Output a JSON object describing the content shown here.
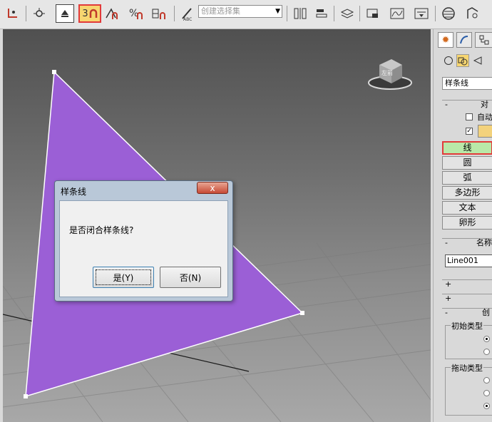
{
  "toolbar": {
    "selection_set_placeholder": "创建选择集",
    "snap_3d_label": "3"
  },
  "dialog": {
    "title": "样条线",
    "close_glyph": "x",
    "message": "是否闭合样条线?",
    "yes_label": "是(Y)",
    "no_label": "否(N)"
  },
  "viewport": {
    "shape_fill": "#9b5fd6",
    "viewcube_text": "左前"
  },
  "panel": {
    "type_dropdown": "样条线",
    "object_type_rollout": {
      "sign": "-",
      "label": "对",
      "auto_grid_label": "自动"
    },
    "object_buttons": [
      "线",
      "圆",
      "弧",
      "多边形",
      "文本",
      "卵形"
    ],
    "name_color_rollout": {
      "sign": "-",
      "label": "名称",
      "name_value": "Line001"
    },
    "rollout_rendering_sign": "+",
    "rollout_interpolation_sign": "+",
    "creation_method_rollout": {
      "sign": "-",
      "label": "创",
      "initial_type_label": "初始类型",
      "drag_type_label": "拖动类型"
    }
  }
}
